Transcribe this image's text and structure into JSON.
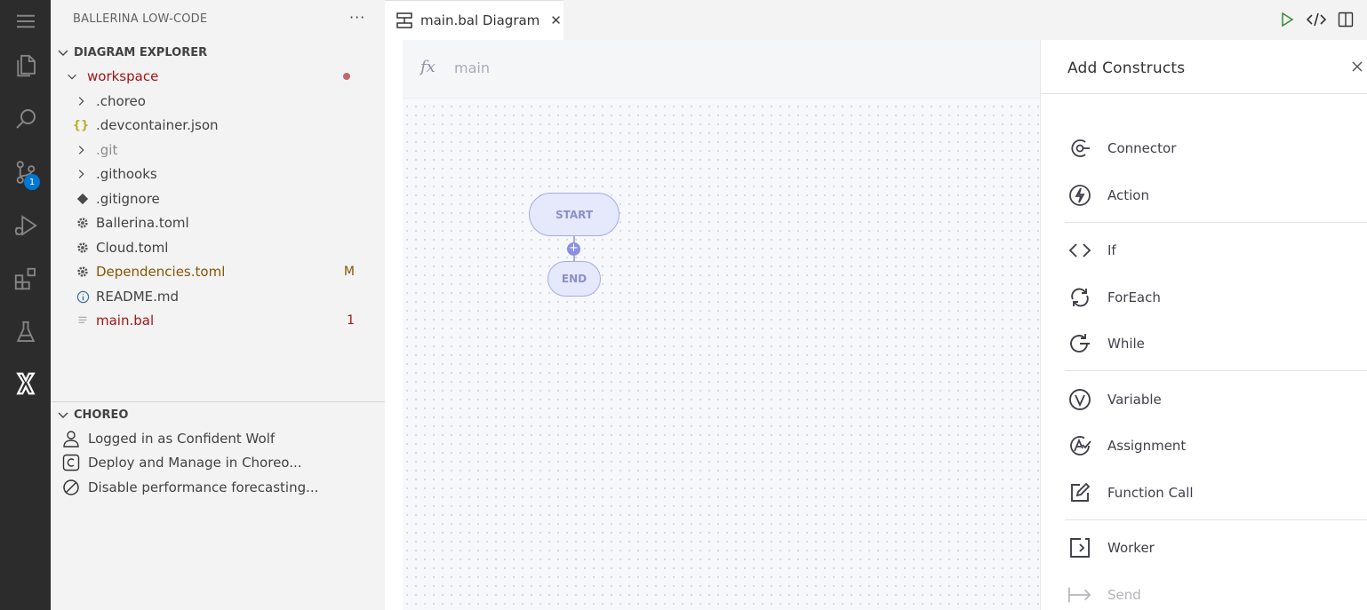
{
  "sidebar": {
    "title": "BALLERINA LOW-CODE",
    "more": "···",
    "explorer": {
      "title": "DIAGRAM EXPLORER",
      "root": "workspace",
      "items": [
        {
          "label": ".choreo",
          "decoration": ""
        },
        {
          "label": ".devcontainer.json",
          "decoration": ""
        },
        {
          "label": ".git",
          "decoration": ""
        },
        {
          "label": ".githooks",
          "decoration": ""
        },
        {
          "label": ".gitignore",
          "decoration": ""
        },
        {
          "label": "Ballerina.toml",
          "decoration": ""
        },
        {
          "label": "Cloud.toml",
          "decoration": ""
        },
        {
          "label": "Dependencies.toml",
          "decoration": "M"
        },
        {
          "label": "README.md",
          "decoration": ""
        },
        {
          "label": "main.bal",
          "decoration": "1"
        }
      ]
    },
    "choreo": {
      "title": "CHOREO",
      "items": [
        {
          "label": "Logged in as Confident Wolf"
        },
        {
          "label": "Deploy and Manage in Choreo..."
        },
        {
          "label": "Disable performance forecasting..."
        }
      ]
    }
  },
  "activity": {
    "source_control_badge": "1"
  },
  "tab": {
    "label": "main.bal Diagram",
    "close": "✕"
  },
  "diagram": {
    "fx": "fx",
    "function_name": "main",
    "start_label": "START",
    "end_label": "END",
    "plus": "+"
  },
  "panel": {
    "title": "Add Constructs",
    "items": [
      {
        "label": "Connector"
      },
      {
        "label": "Action"
      },
      {
        "label": "If"
      },
      {
        "label": "ForEach"
      },
      {
        "label": "While"
      },
      {
        "label": "Variable"
      },
      {
        "label": "Assignment"
      },
      {
        "label": "Function Call"
      },
      {
        "label": "Worker"
      },
      {
        "label": "Send"
      }
    ]
  },
  "colors": {
    "activity_bg": "#2c2c2c",
    "accent_badge": "#0078d4",
    "modified": "#895503",
    "error_red": "#a31515",
    "node_fill": "#e6e8fb",
    "node_stroke": "#a6abe8"
  }
}
